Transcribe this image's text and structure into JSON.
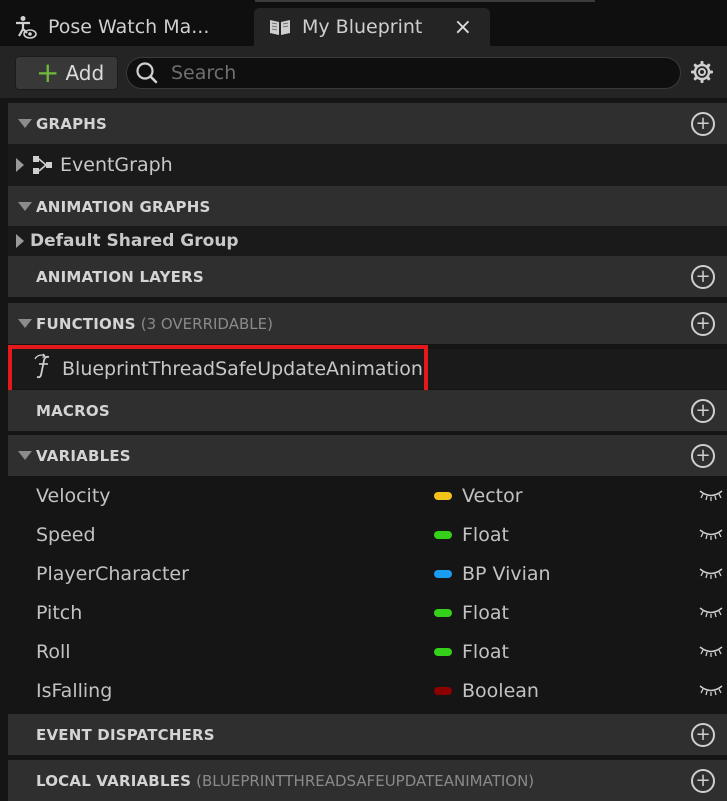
{
  "tabs": {
    "pose_watch": {
      "label": "Pose Watch Ma..."
    },
    "my_blueprint": {
      "label": "My Blueprint",
      "close": "×"
    }
  },
  "toolbar": {
    "add_label": "Add",
    "add_symbol": "+",
    "search_placeholder": "Search"
  },
  "sections": {
    "graphs": {
      "title": "GRAPHS",
      "items": [
        {
          "label": "EventGraph"
        }
      ]
    },
    "animation_graphs": {
      "title": "ANIMATION GRAPHS",
      "items": [
        {
          "label": "Default Shared Group"
        }
      ]
    },
    "animation_layers": {
      "title": "ANIMATION LAYERS"
    },
    "functions": {
      "title": "FUNCTIONS",
      "subtitle": "(3 OVERRIDABLE)",
      "items": [
        {
          "label": "BlueprintThreadSafeUpdateAnimation"
        }
      ]
    },
    "macros": {
      "title": "MACROS"
    },
    "variables": {
      "title": "VARIABLES",
      "items": [
        {
          "name": "Velocity",
          "type": "Vector",
          "color": "#f2c21b"
        },
        {
          "name": "Speed",
          "type": "Float",
          "color": "#35d01a"
        },
        {
          "name": "PlayerCharacter",
          "type": "BP Vivian",
          "color": "#1a9cf2"
        },
        {
          "name": "Pitch",
          "type": "Float",
          "color": "#35d01a"
        },
        {
          "name": "Roll",
          "type": "Float",
          "color": "#35d01a"
        },
        {
          "name": "IsFalling",
          "type": "Boolean",
          "color": "#8c0000"
        }
      ]
    },
    "event_dispatchers": {
      "title": "EVENT DISPATCHERS"
    },
    "local_variables": {
      "title": "LOCAL VARIABLES",
      "subtitle": "(BLUEPRINTTHREADSAFEUPDATEANIMATION)"
    }
  },
  "colors": {
    "highlight": "#e3191c",
    "accent_add": "#6fba3b"
  }
}
